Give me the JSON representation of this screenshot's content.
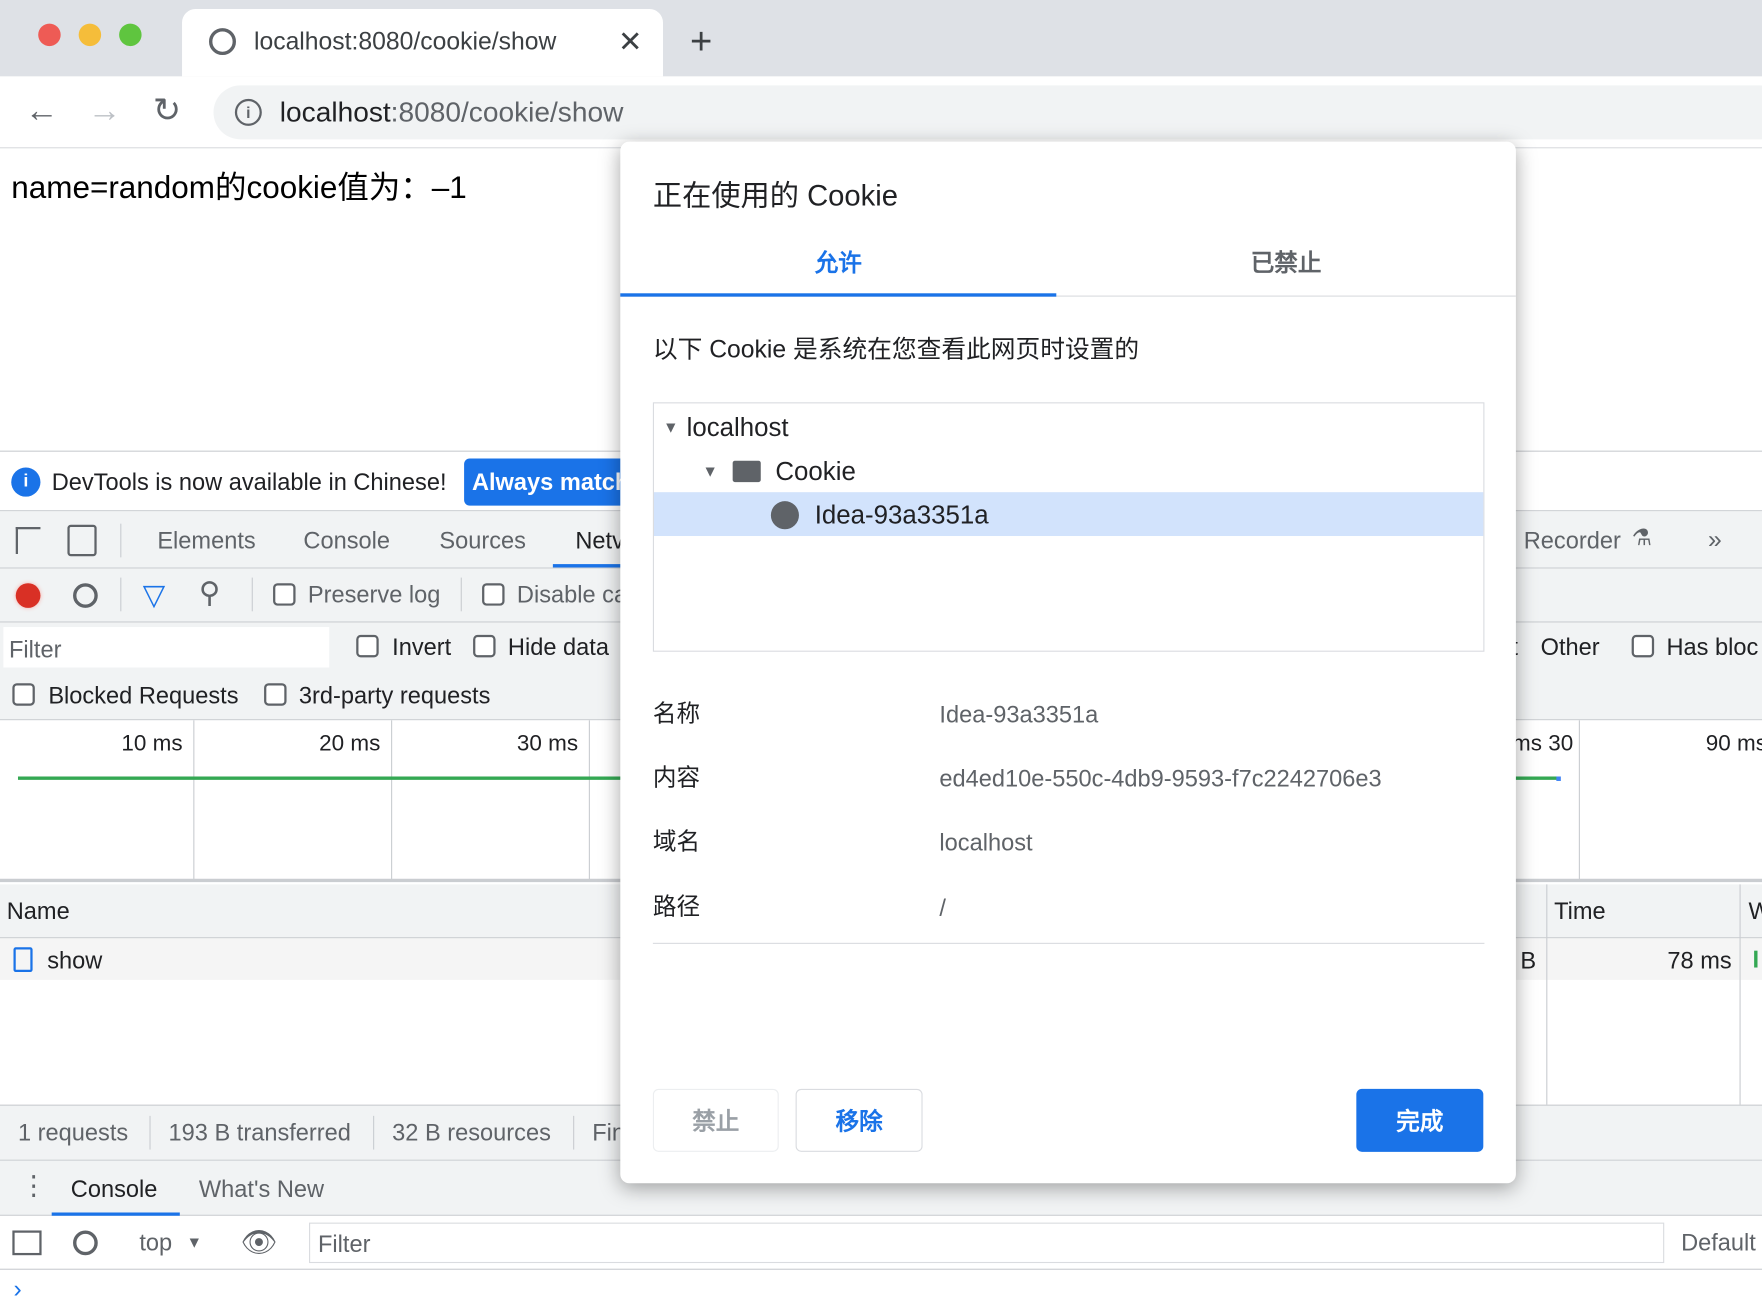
{
  "browser": {
    "tab_title": "localhost:8080/cookie/show",
    "url_host": "localhost",
    "url_path": ":8080/cookie/show"
  },
  "page": {
    "text": "name=random的cookie值为：–1"
  },
  "devtools": {
    "infobar": {
      "message": "DevTools is now available in Chinese!",
      "button": "Always match"
    },
    "tabs": [
      "Elements",
      "Console",
      "Sources",
      "Netv",
      "Recorder"
    ],
    "toolbar": {
      "preserve_log": "Preserve log",
      "disable_cache": "Disable ca"
    },
    "filter": {
      "placeholder": "Filter",
      "invert": "Invert",
      "hide_data": "Hide data",
      "other": "Other",
      "t": "t",
      "has_blocked": "Has bloc"
    },
    "row2": {
      "blocked": "Blocked Requests",
      "third_party": "3rd-party requests"
    },
    "timeline": {
      "ticks": [
        "10 ms",
        "20 ms",
        "30 ms",
        "30 ms",
        "90 ms"
      ]
    },
    "table": {
      "headers": {
        "name": "Name",
        "time": "Time",
        "w": "W"
      },
      "rows": [
        {
          "name": "show",
          "size": "B",
          "time": "78 ms"
        }
      ]
    },
    "status": [
      "1 requests",
      "193 B transferred",
      "32 B resources",
      "Fin"
    ],
    "drawer": {
      "tabs": [
        "Console",
        "What's New"
      ],
      "context": "top",
      "filter_placeholder": "Filter",
      "levels": "Default"
    }
  },
  "dialog": {
    "title": "正在使用的 Cookie",
    "tabs": [
      {
        "label": "允许",
        "active": true
      },
      {
        "label": "已禁止",
        "active": false
      }
    ],
    "description": "以下 Cookie 是系统在您查看此网页时设置的",
    "tree": {
      "site": "localhost",
      "folder": "Cookie",
      "cookie": "Idea-93a3351a"
    },
    "details": [
      {
        "label": "名称",
        "value": "Idea-93a3351a"
      },
      {
        "label": "内容",
        "value": "ed4ed10e-550c-4db9-9593-f7c2242706e3"
      },
      {
        "label": "域名",
        "value": "localhost"
      },
      {
        "label": "路径",
        "value": "/"
      }
    ],
    "buttons": {
      "block": "禁止",
      "remove": "移除",
      "done": "完成"
    },
    "accent": "#1a73e8"
  }
}
